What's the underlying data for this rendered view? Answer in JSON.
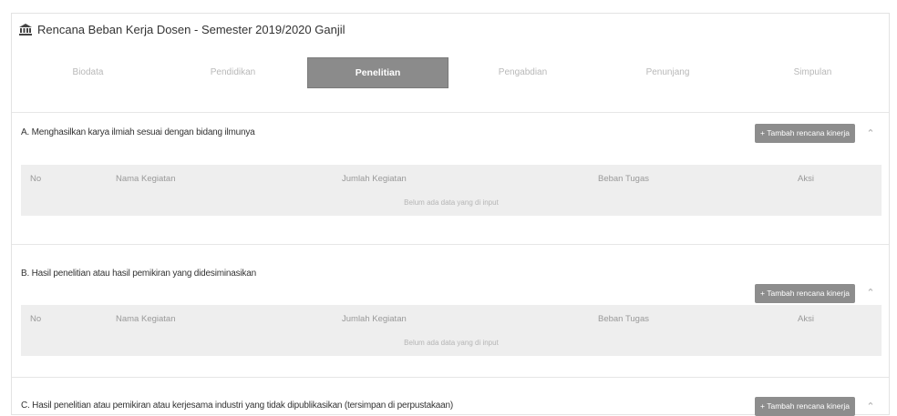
{
  "page": {
    "title": "Rencana Beban Kerja Dosen - Semester 2019/2020 Ganjil"
  },
  "tabs": [
    {
      "label": "Biodata"
    },
    {
      "label": "Pendidikan"
    },
    {
      "label": "Penelitian",
      "active": true
    },
    {
      "label": "Pengabdian"
    },
    {
      "label": "Penunjang"
    },
    {
      "label": "Simpulan"
    }
  ],
  "table_headers": {
    "no": "No",
    "nama": "Nama Kegiatan",
    "jumlah": "Jumlah Kegiatan",
    "beban": "Beban Tugas",
    "aksi": "Aksi"
  },
  "sections": [
    {
      "title": "A. Menghasilkan karya ilmiah sesuai dengan bidang ilmunya",
      "add_label": "+ Tambah rencana kinerja",
      "empty_text": "Belum ada data yang di input"
    },
    {
      "title": "B. Hasil penelitian atau hasil pemikiran yang didesiminasikan",
      "add_label": "+ Tambah rencana kinerja",
      "empty_text": "Belum ada data yang di input"
    },
    {
      "title": "C. Hasil penelitian atau pemikiran atau kerjesama industri yang tidak dipublikasikan (tersimpan di perpustakaan)",
      "add_label": "+ Tambah rencana kinerja"
    }
  ],
  "icons": {
    "title_icon": "bank-icon",
    "collapse_icon": "chevron-up-icon"
  }
}
